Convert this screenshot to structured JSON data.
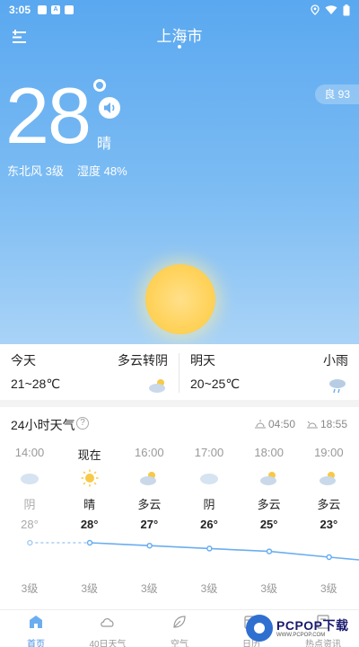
{
  "status_bar": {
    "time": "3:05",
    "icons": [
      "notification-icon",
      "text-icon",
      "app-icon",
      "location-icon",
      "wifi-icon",
      "battery-icon"
    ]
  },
  "header": {
    "city": "上海市"
  },
  "current": {
    "temperature": "28",
    "condition": "晴",
    "wind": "东北风 3级",
    "humidity": "湿度 48%",
    "aqi": "良 93"
  },
  "forecast": {
    "today": {
      "label": "今天",
      "condition": "多云转阴",
      "range": "21~28℃",
      "icon": "cloudy-icon"
    },
    "tomorrow": {
      "label": "明天",
      "condition": "小雨",
      "range": "20~25℃",
      "icon": "light-rain-icon"
    }
  },
  "hourly": {
    "title": "24小时天气",
    "help": "?",
    "sunrise": "04:50",
    "sunset": "18:55",
    "items": [
      {
        "time": "14:00",
        "condition": "阴",
        "temp": "28°",
        "wind": "3级",
        "icon": "overcast-icon",
        "past": true,
        "value": 28
      },
      {
        "time": "现在",
        "condition": "晴",
        "temp": "28°",
        "wind": "3级",
        "icon": "sunny-icon",
        "past": false,
        "value": 28
      },
      {
        "time": "16:00",
        "condition": "多云",
        "temp": "27°",
        "wind": "3级",
        "icon": "partly-cloudy-icon",
        "past": false,
        "value": 27
      },
      {
        "time": "17:00",
        "condition": "阴",
        "temp": "26°",
        "wind": "3级",
        "icon": "overcast-icon",
        "past": false,
        "value": 26
      },
      {
        "time": "18:00",
        "condition": "多云",
        "temp": "25°",
        "wind": "3级",
        "icon": "partly-cloudy-icon",
        "past": false,
        "value": 25
      },
      {
        "time": "19:00",
        "condition": "多云",
        "temp": "23°",
        "wind": "3级",
        "icon": "partly-cloudy-icon",
        "past": false,
        "value": 23
      }
    ]
  },
  "tabs": [
    {
      "label": "首页",
      "icon": "home-icon",
      "active": true
    },
    {
      "label": "40日天气",
      "icon": "cloud-icon",
      "active": false
    },
    {
      "label": "空气",
      "icon": "leaf-icon",
      "active": false
    },
    {
      "label": "日历",
      "icon": "calendar-icon",
      "active": false
    },
    {
      "label": "热点资讯",
      "icon": "news-icon",
      "active": false
    }
  ],
  "watermark": {
    "brand": "PCPOP下载",
    "sub": "WWW.PCPOP.COM"
  },
  "colors": {
    "sky_top": "#5aa8f0",
    "sky_bottom": "#a9d3f7",
    "sun": "#ffd25a",
    "accent": "#4a90e2"
  }
}
